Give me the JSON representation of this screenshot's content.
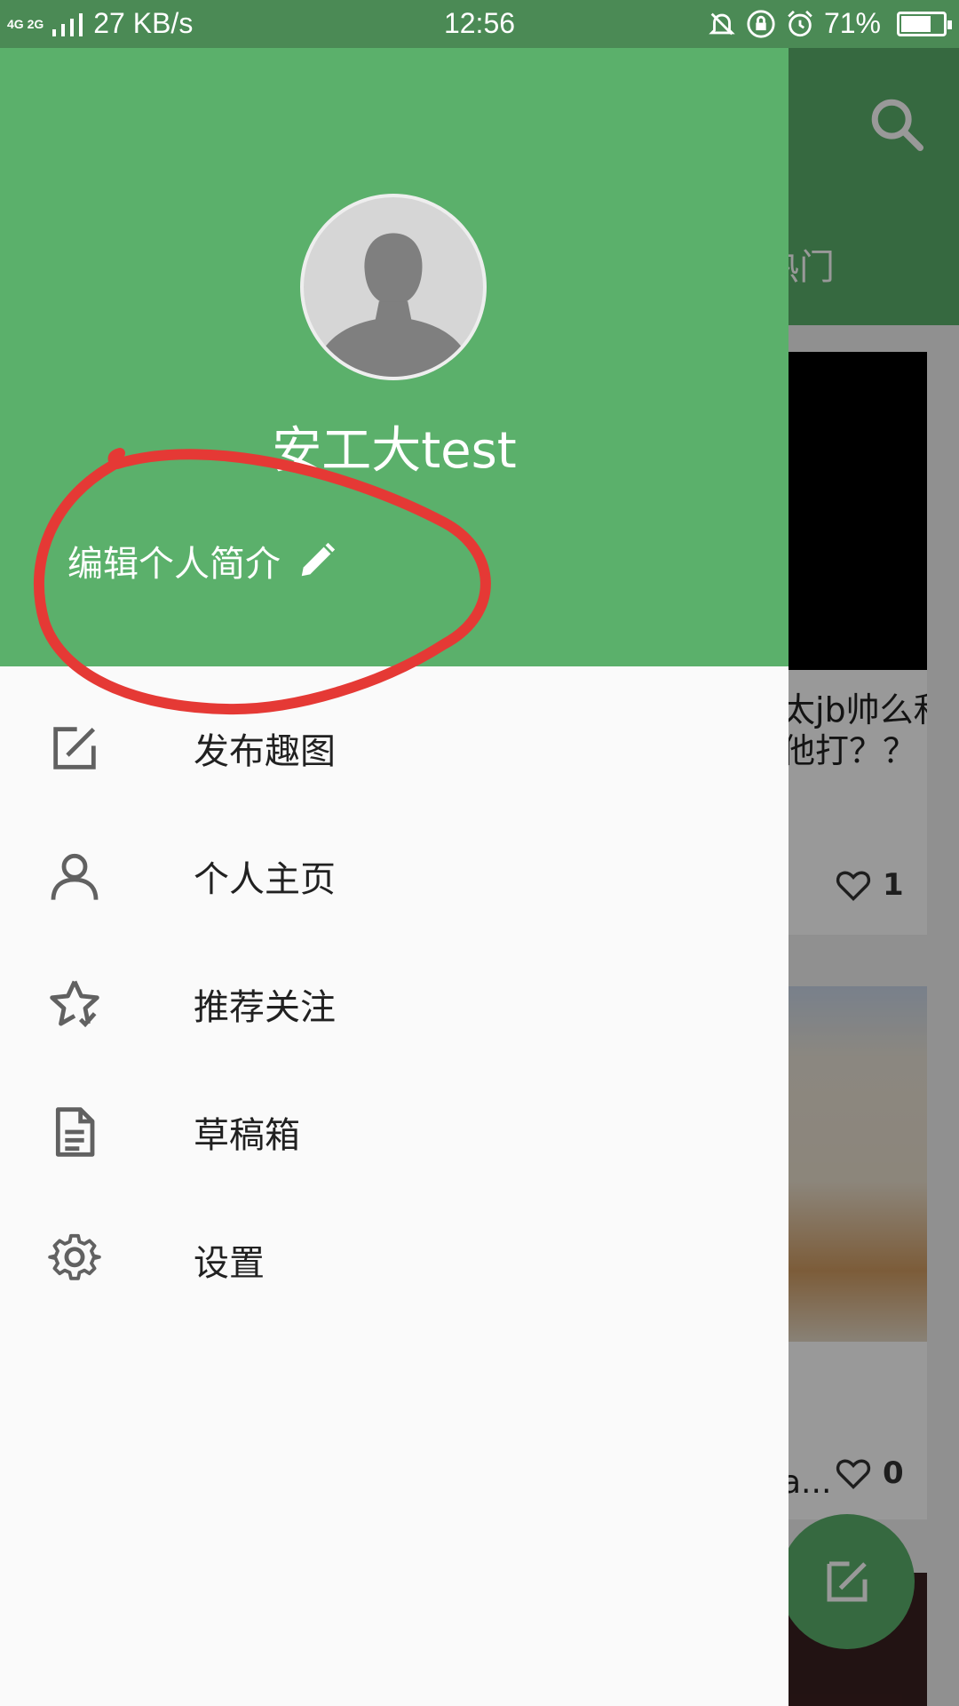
{
  "status_bar": {
    "network": "4G 2G",
    "speed": "27 KB/s",
    "time": "12:56",
    "battery_percent": "71%",
    "battery_level": 0.71
  },
  "drawer": {
    "username": "安工大test",
    "edit_bio_label": "编辑个人简介",
    "menu": [
      {
        "label": "发布趣图",
        "icon": "edit-square-icon"
      },
      {
        "label": "个人主页",
        "icon": "person-icon"
      },
      {
        "label": "推荐关注",
        "icon": "star-check-icon"
      },
      {
        "label": "草稿箱",
        "icon": "document-icon"
      },
      {
        "label": "设置",
        "icon": "gear-icon"
      }
    ]
  },
  "background": {
    "tab_partial": "热门",
    "card1_text": "太jb帅么和他打？？",
    "card1_likes": "1",
    "card2_ellipsis": "a...",
    "card2_likes": "0"
  },
  "colors": {
    "primary": "#5bb06b",
    "status_bar": "#4b8a55",
    "annotation": "#e53935"
  }
}
